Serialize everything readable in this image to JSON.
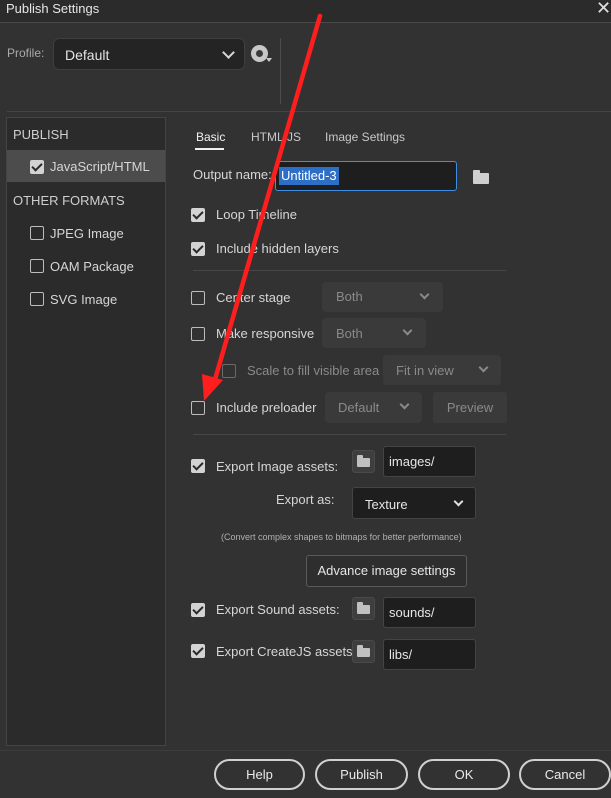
{
  "window": {
    "title": "Publish Settings",
    "close_glyph": "✕"
  },
  "profile": {
    "label": "Profile:",
    "value": "Default"
  },
  "left_panel": {
    "publish_header": "PUBLISH",
    "publish_items": [
      {
        "label": "JavaScript/HTML",
        "checked": true,
        "selected": true
      }
    ],
    "other_header": "OTHER FORMATS",
    "other_items": [
      {
        "label": "JPEG Image",
        "checked": false
      },
      {
        "label": "OAM Package",
        "checked": false
      },
      {
        "label": "SVG Image",
        "checked": false
      }
    ]
  },
  "tabs": [
    "Basic",
    "HTML/JS",
    "Image Settings"
  ],
  "basic": {
    "output_name_label": "Output name:",
    "output_name_value": "Untitled-3",
    "loop_timeline": {
      "label": "Loop Timeline",
      "checked": true
    },
    "include_hidden_layers": {
      "label": "Include hidden layers",
      "checked": true
    },
    "center_stage": {
      "label": "Center stage",
      "checked": false,
      "dropdown": "Both"
    },
    "make_responsive": {
      "label": "Make responsive",
      "checked": false,
      "dropdown": "Both"
    },
    "scale_to_fill": {
      "label": "Scale to fill visible area",
      "checked": false,
      "dropdown": "Fit in view"
    },
    "include_preloader": {
      "label": "Include preloader",
      "checked": false,
      "dropdown": "Default",
      "preview_label": "Preview"
    },
    "export_image_assets": {
      "label": "Export Image assets:",
      "checked": true,
      "path": "images/"
    },
    "export_as": {
      "label": "Export as:",
      "value": "Texture"
    },
    "hint": "(Convert complex shapes to bitmaps for better performance)",
    "advance_button": "Advance image settings",
    "export_sound_assets": {
      "label": "Export Sound assets:",
      "checked": true,
      "path": "sounds/"
    },
    "export_createjs_assets": {
      "label": "Export CreateJS assets:",
      "checked": true,
      "path": "libs/"
    }
  },
  "footer": {
    "help": "Help",
    "publish": "Publish",
    "ok": "OK",
    "cancel": "Cancel"
  },
  "icons": [
    "gear-icon",
    "folder-icon",
    "chevron-down-icon",
    "checkbox-icon",
    "close-icon"
  ],
  "colors": {
    "background": "#323232",
    "selection": "#2d6ec7",
    "focus_border": "#3f8ee6",
    "annotation_arrow": "#ff1e1e"
  }
}
